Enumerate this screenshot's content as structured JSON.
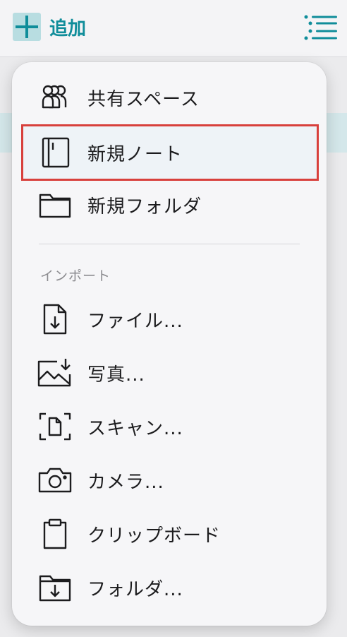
{
  "toolbar": {
    "add_label": "追加"
  },
  "menu": {
    "items": [
      {
        "label": "共有スペース",
        "icon": "shared-space-icon"
      },
      {
        "label": "新規ノート",
        "icon": "notebook-icon",
        "highlighted": true
      },
      {
        "label": "新規フォルダ",
        "icon": "folder-icon"
      }
    ],
    "import_section": "インポート",
    "import_items": [
      {
        "label": "ファイル...",
        "icon": "file-import-icon"
      },
      {
        "label": "写真...",
        "icon": "photo-import-icon"
      },
      {
        "label": "スキャン...",
        "icon": "scan-icon"
      },
      {
        "label": "カメラ...",
        "icon": "camera-icon"
      },
      {
        "label": "クリップボード",
        "icon": "clipboard-icon"
      },
      {
        "label": "フォルダ...",
        "icon": "folder-import-icon"
      }
    ]
  },
  "colors": {
    "accent": "#0f8d9a",
    "highlight_border": "#d8403c"
  }
}
